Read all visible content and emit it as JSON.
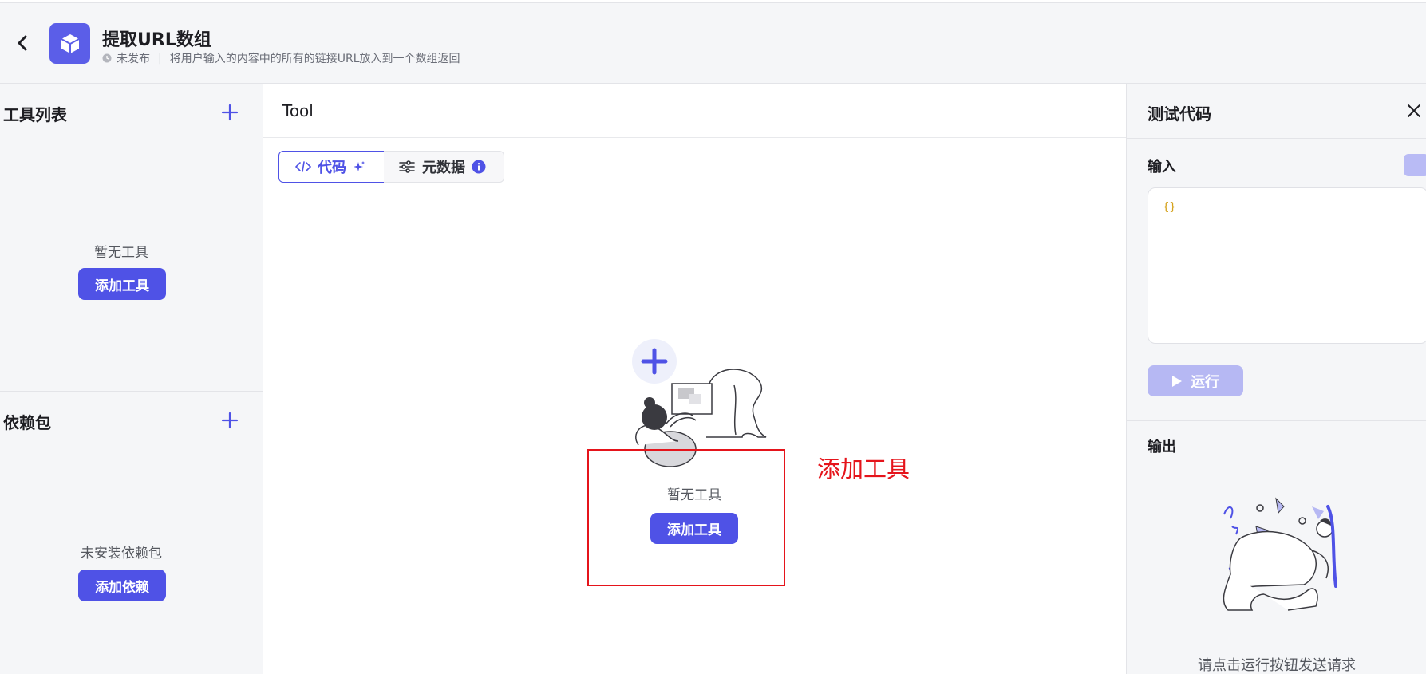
{
  "header": {
    "title": "提取URL数组",
    "status": "未发布",
    "description": "将用户输入的内容中的所有的链接URL放入到一个数组返回",
    "brand_color": "#5b5ee8"
  },
  "left": {
    "tools": {
      "title": "工具列表",
      "empty_text": "暂无工具",
      "add_button": "添加工具"
    },
    "deps": {
      "title": "依赖包",
      "empty_text": "未安装依赖包",
      "add_button": "添加依赖"
    }
  },
  "center": {
    "title": "Tool",
    "tabs": [
      {
        "label": "代码",
        "icon": "code-icon",
        "active": true
      },
      {
        "label": "元数据",
        "icon": "sliders-icon",
        "active": false
      }
    ],
    "empty_text": "暂无工具",
    "add_button": "添加工具",
    "annotation_label": "添加工具",
    "annotation_color": "#e5141b"
  },
  "right": {
    "title": "测试代码",
    "input_label": "输入",
    "input_value": "{}",
    "run_button": "运行",
    "output_label": "输出",
    "output_hint": "请点击运行按钮发送请求"
  },
  "colors": {
    "primary": "#4f52e6",
    "disabled_primary": "#b6b8f3",
    "background": "#f5f6f8"
  }
}
